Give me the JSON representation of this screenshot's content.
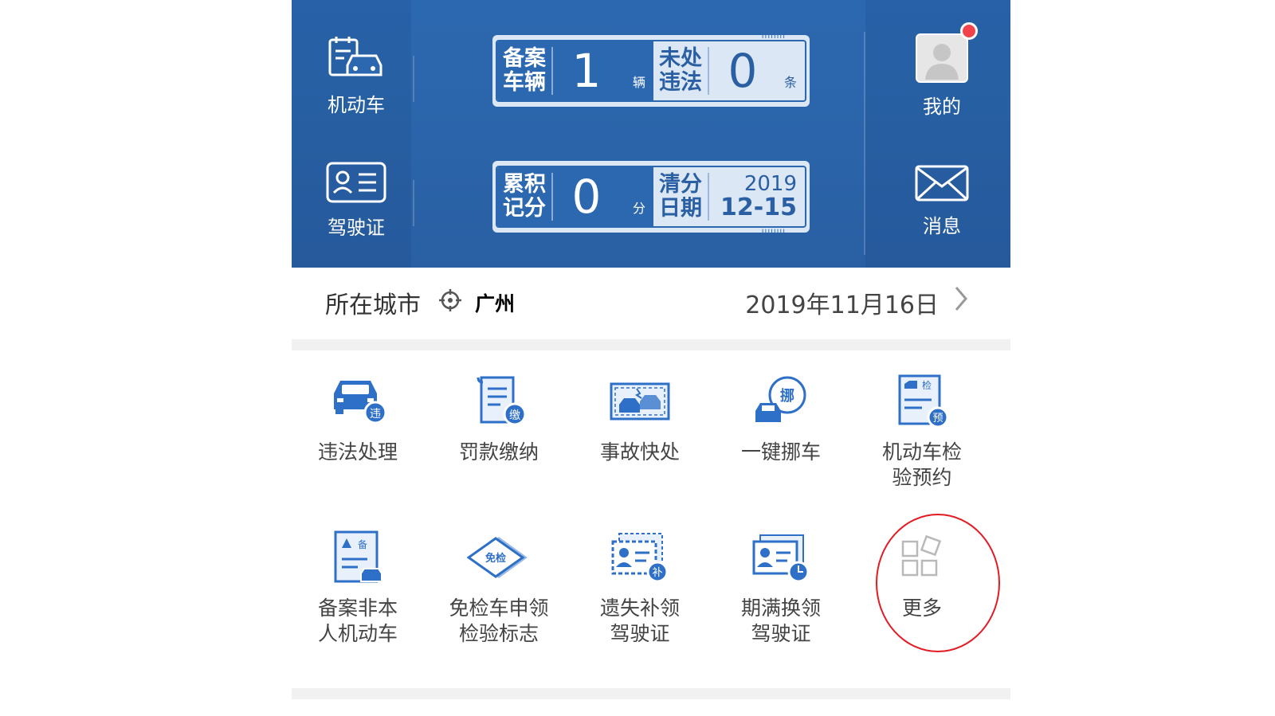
{
  "header": {
    "left_items": [
      {
        "label": "机动车",
        "icon": "car-document-icon"
      },
      {
        "label": "驾驶证",
        "icon": "id-card-icon"
      }
    ],
    "right_items": [
      {
        "label": "我的",
        "icon": "avatar-icon"
      },
      {
        "label": "消息",
        "icon": "envelope-icon"
      }
    ],
    "card1": {
      "left_title": "备案\n车辆",
      "left_value": "1",
      "left_unit": "辆",
      "right_title": "未处\n违法",
      "right_value": "0",
      "right_unit": "条"
    },
    "card2": {
      "left_title": "累积\n记分",
      "left_value": "0",
      "left_unit": "分",
      "right_title": "清分\n日期",
      "right_year": "2019",
      "right_date": "12-15"
    }
  },
  "city_row": {
    "label": "所在城市",
    "city": "广州",
    "date": "2019年11月16日"
  },
  "services": [
    {
      "label": "违法处理",
      "icon": "car-violation-icon"
    },
    {
      "label": "罚款缴纳",
      "icon": "fine-payment-icon"
    },
    {
      "label": "事故快处",
      "icon": "accident-icon"
    },
    {
      "label": "一键挪车",
      "icon": "move-car-icon"
    },
    {
      "label": "机动车检\n验预约",
      "icon": "inspection-booking-icon"
    },
    {
      "label": "备案非本\n人机动车",
      "icon": "register-vehicle-icon"
    },
    {
      "label": "免检车申领\n检验标志",
      "icon": "exempt-sticker-icon"
    },
    {
      "label": "遗失补领\n驾驶证",
      "icon": "replace-license-icon"
    },
    {
      "label": "期满换领\n驾驶证",
      "icon": "renew-license-icon"
    },
    {
      "label": "更多",
      "icon": "more-grid-icon"
    }
  ],
  "colors": {
    "header_blue": "#2c68b0",
    "icon_blue": "#2e6fc7",
    "annotation_red": "#e31b23"
  }
}
